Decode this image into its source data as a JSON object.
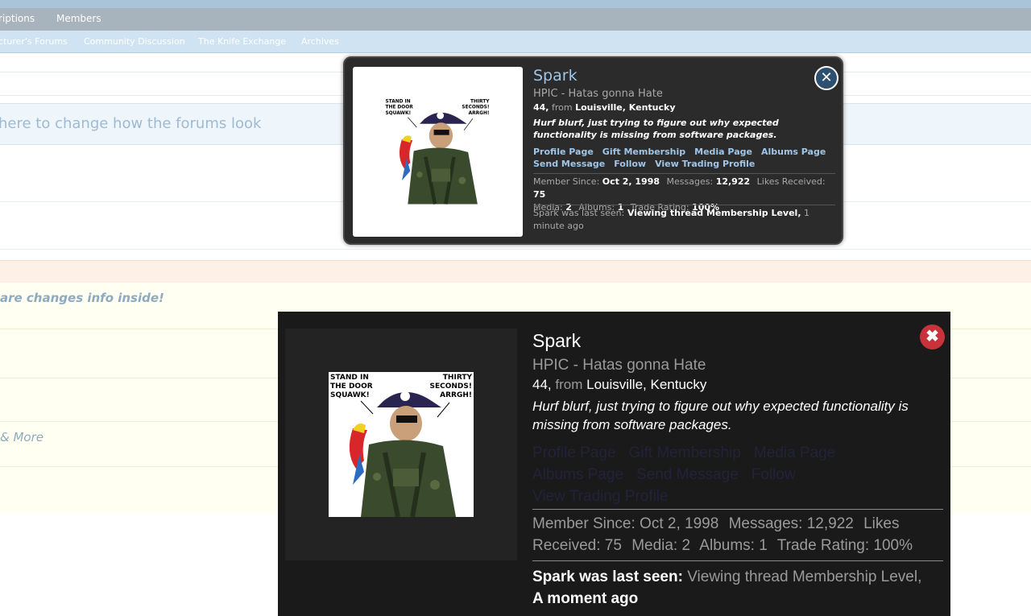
{
  "nav": {
    "primary": [
      "riptions",
      "Members"
    ],
    "secondary": [
      "cturer's Forums",
      "Community Discussion",
      "The Knife Exchange",
      "Archives"
    ]
  },
  "page": {
    "style_notice": "here to change how the forums look",
    "announcement": "are changes info inside!",
    "more_link": "& More"
  },
  "avatar": {
    "caption_left": "STAND IN THE DOOR SQUAWK!",
    "caption_right": "THIRTY SECONDS! ARRGH!"
  },
  "small_card": {
    "name": "Spark",
    "user_title": "HPIC - Hatas gonna Hate",
    "age": "44,",
    "from_label": "from",
    "location": "Louisville, Kentucky",
    "status": "Hurf blurf, just trying to figure out why expected functionality is missing from software packages.",
    "links": [
      "Profile Page",
      "Gift Membership",
      "Media Page",
      "Albums Page",
      "Send Message",
      "Follow",
      "View Trading Profile"
    ],
    "stats": [
      {
        "label": "Member Since:",
        "value": "Oct 2, 1998"
      },
      {
        "label": "Messages:",
        "value": "12,922"
      },
      {
        "label": "Likes Received:",
        "value": "75"
      },
      {
        "label": "Media:",
        "value": "2"
      },
      {
        "label": "Albums:",
        "value": "1"
      },
      {
        "label": "Trade Rating:",
        "value": "100%"
      }
    ],
    "last_seen_label": "Spark was last seen:",
    "last_seen_activity": "Viewing thread Membership Level,",
    "last_seen_time": "1 minute ago",
    "close_icon": "close-circle-icon"
  },
  "large_card": {
    "name": "Spark",
    "user_title": "HPIC - Hatas gonna Hate",
    "age": "44,",
    "from_label": "from",
    "location": "Louisville, Kentucky",
    "status": "Hurf blurf, just trying to figure out why expected functionality is missing from software packages.",
    "links": [
      "Profile Page",
      "Gift Membership",
      "Media Page",
      "Albums Page",
      "Send Message",
      "Follow",
      "View Trading Profile"
    ],
    "stats_text": "Member Since: Oct 2, 1998   Messages: 12,922   Likes Received: 75   Media: 2   Albums: 1   Trade Rating: 100%",
    "stats": [
      "Member Since: Oct 2, 1998",
      "Messages: 12,922",
      "Likes Received: 75",
      "Media: 2",
      "Albums: 1",
      "Trade Rating: 100%"
    ],
    "last_seen_label": "Spark was last seen:",
    "last_seen_activity": "Viewing thread Membership Level,",
    "last_seen_time": "A moment ago",
    "close_icon": "close-x-icon"
  },
  "colors": {
    "accent_blue": "#9fc6e8",
    "close_red": "#c8323a",
    "close_blue": "#2d5070"
  }
}
